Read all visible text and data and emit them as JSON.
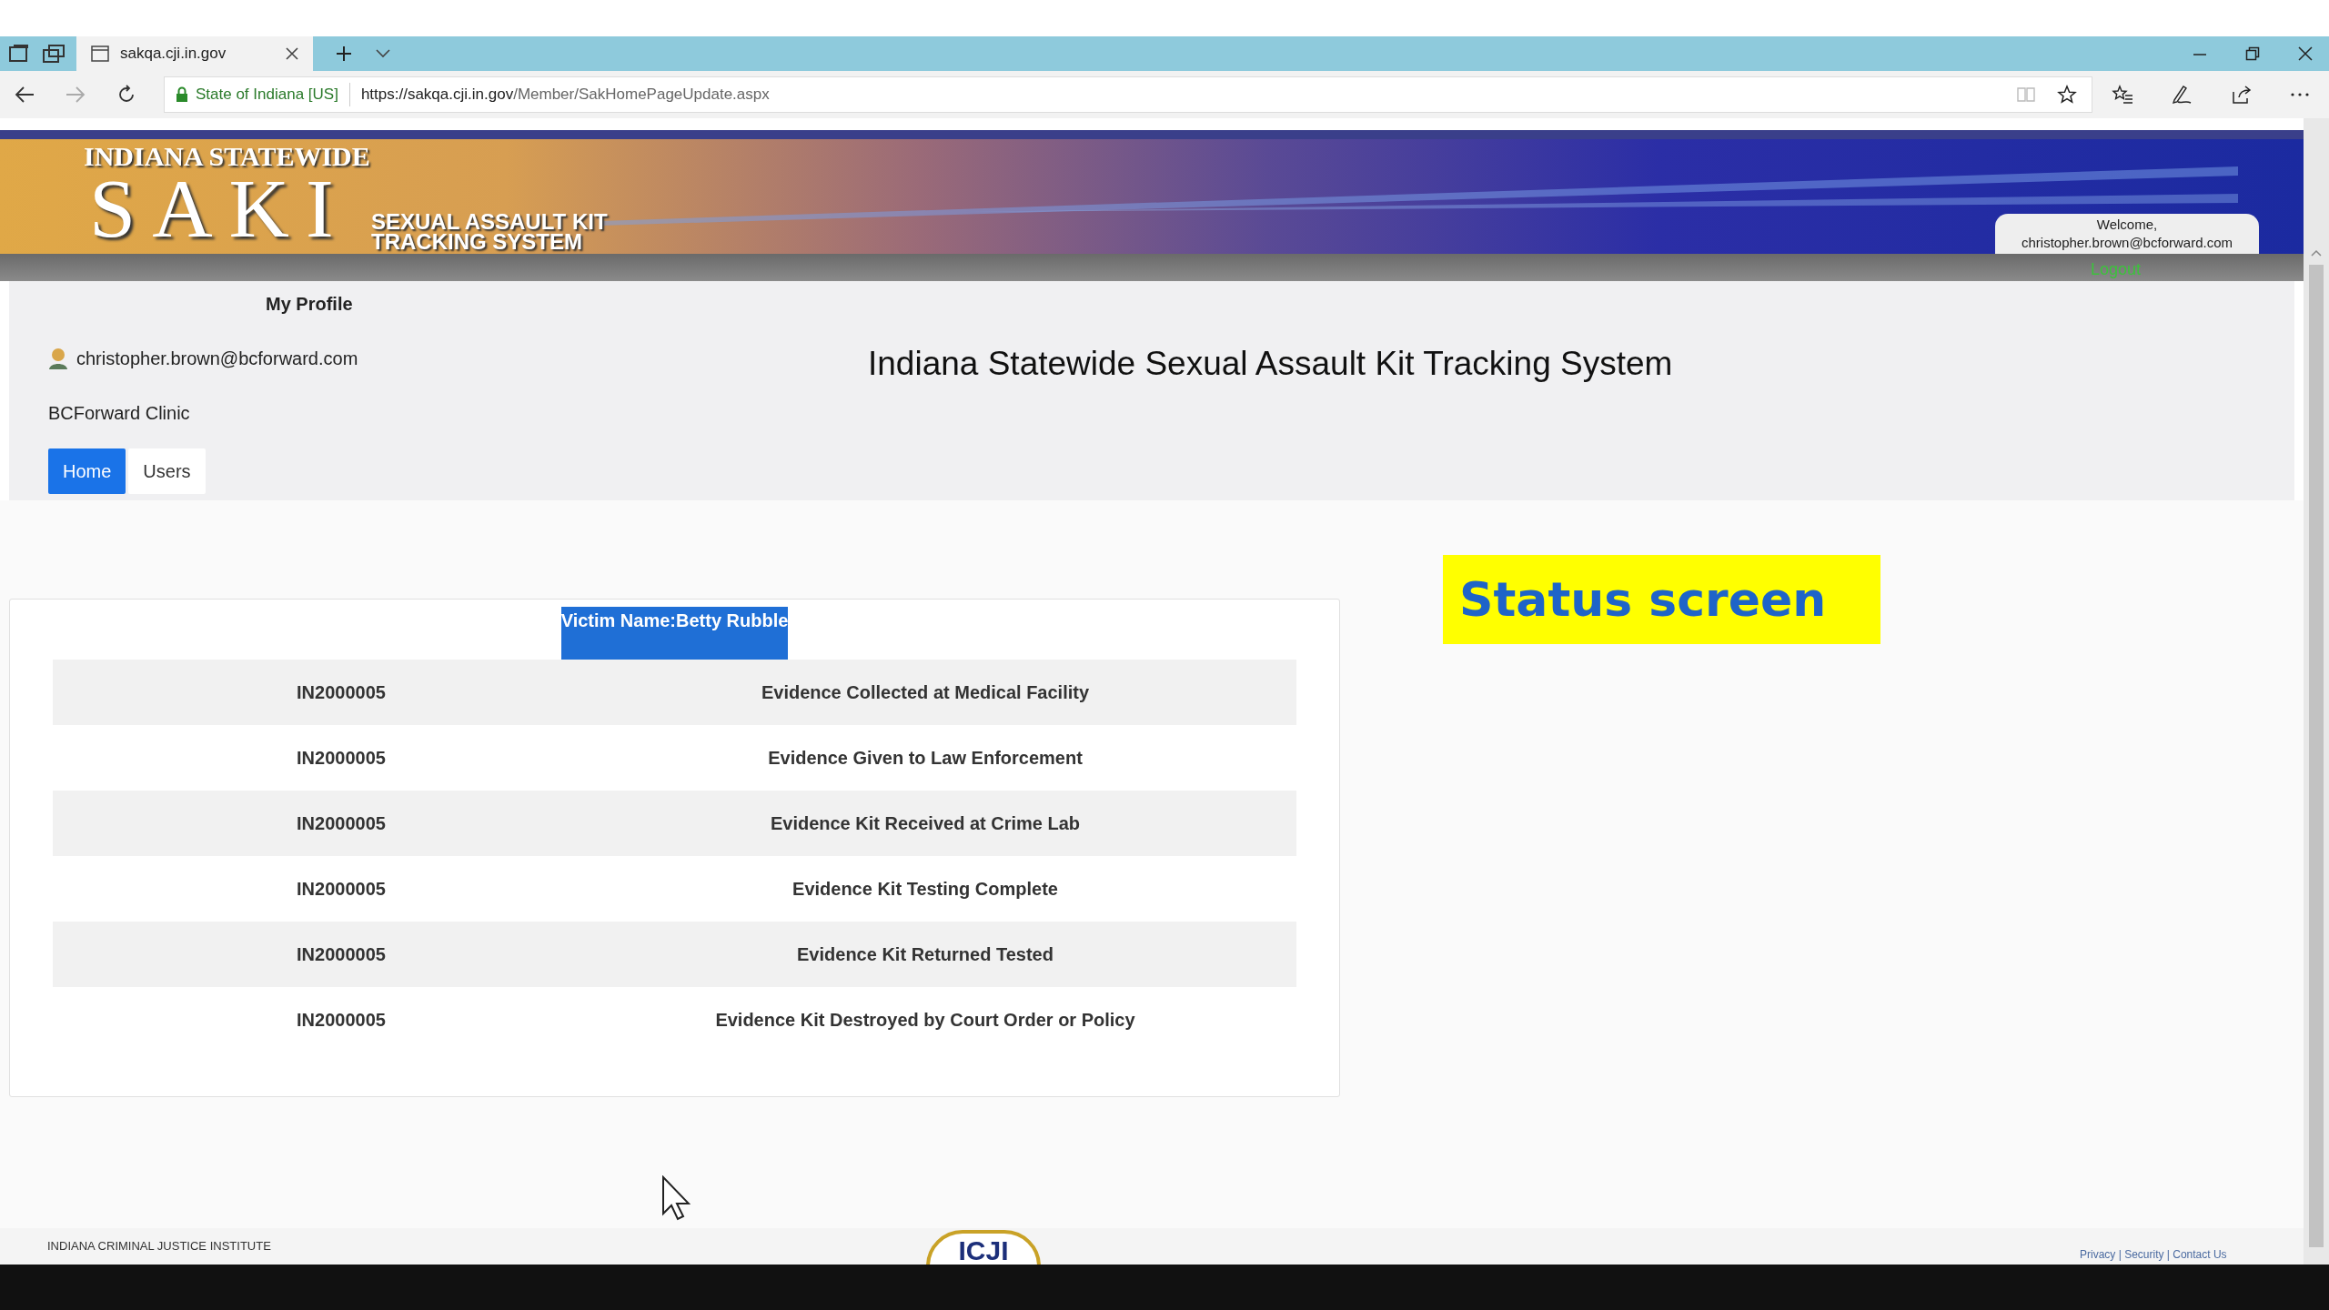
{
  "browser": {
    "tab_title": "sakqa.cji.in.gov",
    "site_identity": "State of Indiana [US]",
    "url_host": "https://sakqa.cji.in.gov",
    "url_path": "/Member/SakHomePageUpdate.aspx"
  },
  "header": {
    "line_1": "INDIANA STATEWIDE",
    "logo": "SAKI",
    "subtitle_1": "SEXUAL ASSAULT KIT",
    "subtitle_2": "TRACKING SYSTEM",
    "welcome": "Welcome,",
    "user": "christopher.brown@bcforward.com",
    "logout": "Logout"
  },
  "profile": {
    "heading": "My Profile",
    "email": "christopher.brown@bcforward.com",
    "clinic": "BCForward Clinic"
  },
  "page_title": "Indiana Statewide Sexual Assault Kit Tracking System",
  "nav": [
    {
      "label": "Home",
      "selected": true
    },
    {
      "label": "Users",
      "selected": false
    }
  ],
  "victim": {
    "label": "Victim Name:Betty Rubble",
    "highlighted": true
  },
  "rows": [
    {
      "kit": "IN2000005",
      "status": "Evidence Collected at Medical Facility"
    },
    {
      "kit": "IN2000005",
      "status": "Evidence Given to Law Enforcement"
    },
    {
      "kit": "IN2000005",
      "status": "Evidence Kit Received at Crime Lab"
    },
    {
      "kit": "IN2000005",
      "status": "Evidence Kit Testing Complete"
    },
    {
      "kit": "IN2000005",
      "status": "Evidence Kit Returned Tested"
    },
    {
      "kit": "IN2000005",
      "status": "Evidence Kit Destroyed by Court Order or Policy"
    }
  ],
  "callout": "Status screen",
  "footer": {
    "org": "INDIANA CRIMINAL JUSTICE INSTITUTE",
    "logo": "ICJI",
    "links": "Privacy | Security | Contact Us"
  }
}
